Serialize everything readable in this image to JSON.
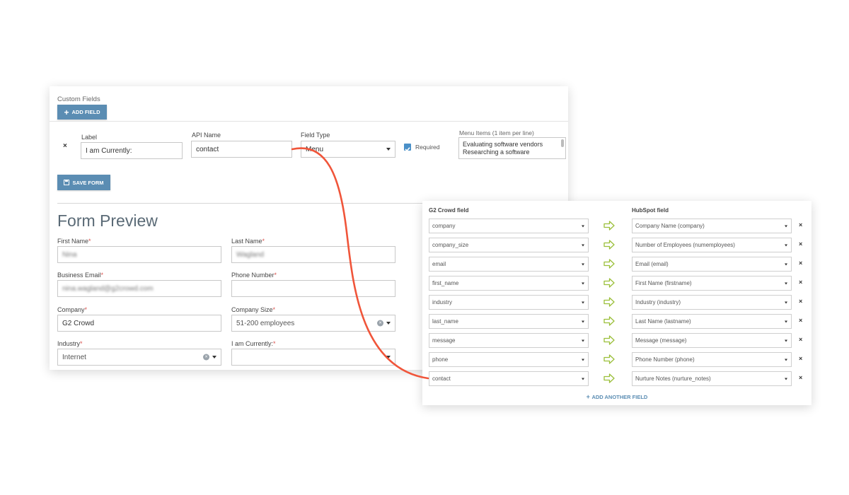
{
  "builder": {
    "section_title": "Custom Fields",
    "add_field_label": "ADD FIELD",
    "remove_symbol": "×",
    "label_header": "Label",
    "label_value": "I am Currently:",
    "api_header": "API Name",
    "api_value": "contact",
    "type_header": "Field Type",
    "type_value": "Menu",
    "required_label": "Required",
    "required_checked": true,
    "menu_header": "Menu Items (1 item per line)",
    "menu_line1": "Evaluating software vendors",
    "menu_line2": "Researching a software",
    "save_label": "SAVE FORM"
  },
  "preview": {
    "title": "Form Preview",
    "required_mark": "*",
    "first_name_label": "First Name",
    "first_name_value": "Nina",
    "last_name_label": "Last Name",
    "last_name_value": "Wagland",
    "email_label": "Business Email",
    "email_value": "nina.wagland@g2crowd.com",
    "phone_label": "Phone Number",
    "phone_value": "",
    "company_label": "Company",
    "company_value": "G2 Crowd",
    "size_label": "Company Size",
    "size_value": "51-200 employees",
    "industry_label": "Industry",
    "industry_value": "Internet",
    "currently_label": "I am Currently:",
    "currently_value": ""
  },
  "mapping": {
    "left_header": "G2 Crowd field",
    "right_header": "HubSpot field",
    "rows": [
      {
        "g2": "company",
        "hubspot": "Company Name (company)"
      },
      {
        "g2": "company_size",
        "hubspot": "Number of Employees (numemployees)"
      },
      {
        "g2": "email",
        "hubspot": "Email (email)"
      },
      {
        "g2": "first_name",
        "hubspot": "First Name (firstname)"
      },
      {
        "g2": "industry",
        "hubspot": "Industry (industry)"
      },
      {
        "g2": "last_name",
        "hubspot": "Last Name (lastname)"
      },
      {
        "g2": "message",
        "hubspot": "Message (message)"
      },
      {
        "g2": "phone",
        "hubspot": "Phone Number (phone)"
      },
      {
        "g2": "contact",
        "hubspot": "Nurture Notes (nurture_notes)"
      }
    ],
    "remove_symbol": "×",
    "add_another_label": "ADD ANOTHER FIELD"
  },
  "colors": {
    "button_blue": "#5b8db3",
    "arrow_green": "#9bbf3a",
    "connector_red": "#f0553a",
    "required_red": "#d9534f"
  }
}
